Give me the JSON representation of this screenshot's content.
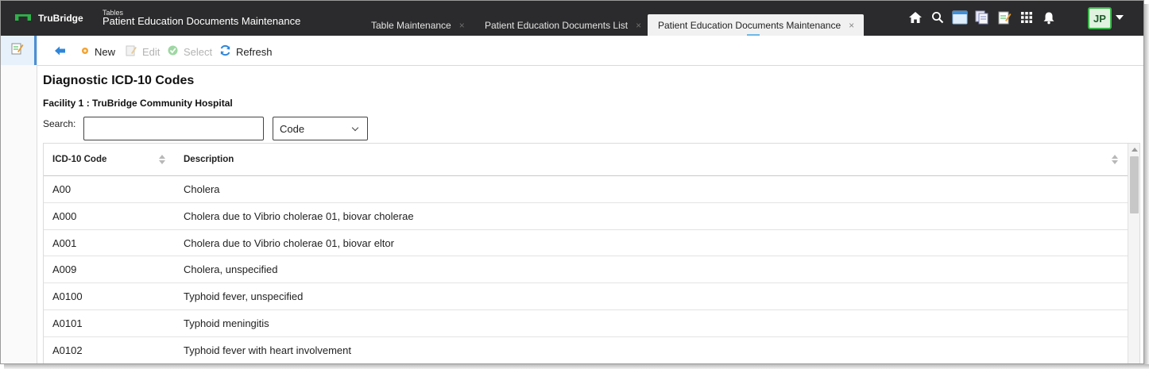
{
  "brand": {
    "name": "TruBridge"
  },
  "header": {
    "section": "Tables",
    "title": "Patient Education Documents Maintenance"
  },
  "tabs": [
    {
      "label": "Table Maintenance",
      "close": "×"
    },
    {
      "label": "Patient Education Documents List",
      "close": "×"
    },
    {
      "label": "Patient Education Documents Maintenance",
      "close": "×",
      "active": true
    }
  ],
  "top_icons": [
    "home-icon",
    "search-icon",
    "window-icon",
    "documents-icon",
    "notepad-icon",
    "apps-grid-icon",
    "bell-icon"
  ],
  "user": {
    "initials": "JP"
  },
  "toolbar": {
    "back_icon": "back-arrow-icon",
    "new_label": "New",
    "edit_label": "Edit",
    "select_label": "Select",
    "refresh_label": "Refresh"
  },
  "page": {
    "heading": "Diagnostic ICD-10 Codes",
    "facility": "Facility 1 : TruBridge Community Hospital",
    "search_label": "Search:",
    "search_value": "",
    "search_by": "Code"
  },
  "table": {
    "columns": [
      "ICD-10 Code",
      "Description"
    ],
    "rows": [
      {
        "code": "A00",
        "description": "Cholera"
      },
      {
        "code": "A000",
        "description": "Cholera due to Vibrio cholerae 01, biovar cholerae"
      },
      {
        "code": "A001",
        "description": "Cholera due to Vibrio cholerae 01, biovar eltor"
      },
      {
        "code": "A009",
        "description": "Cholera, unspecified"
      },
      {
        "code": "A0100",
        "description": "Typhoid fever, unspecified"
      },
      {
        "code": "A0101",
        "description": "Typhoid meningitis"
      },
      {
        "code": "A0102",
        "description": "Typhoid fever with heart involvement"
      }
    ]
  },
  "colors": {
    "topbar": "#2b2b2d",
    "brand_green": "#2fb24a",
    "accent_blue": "#4a90d6"
  }
}
